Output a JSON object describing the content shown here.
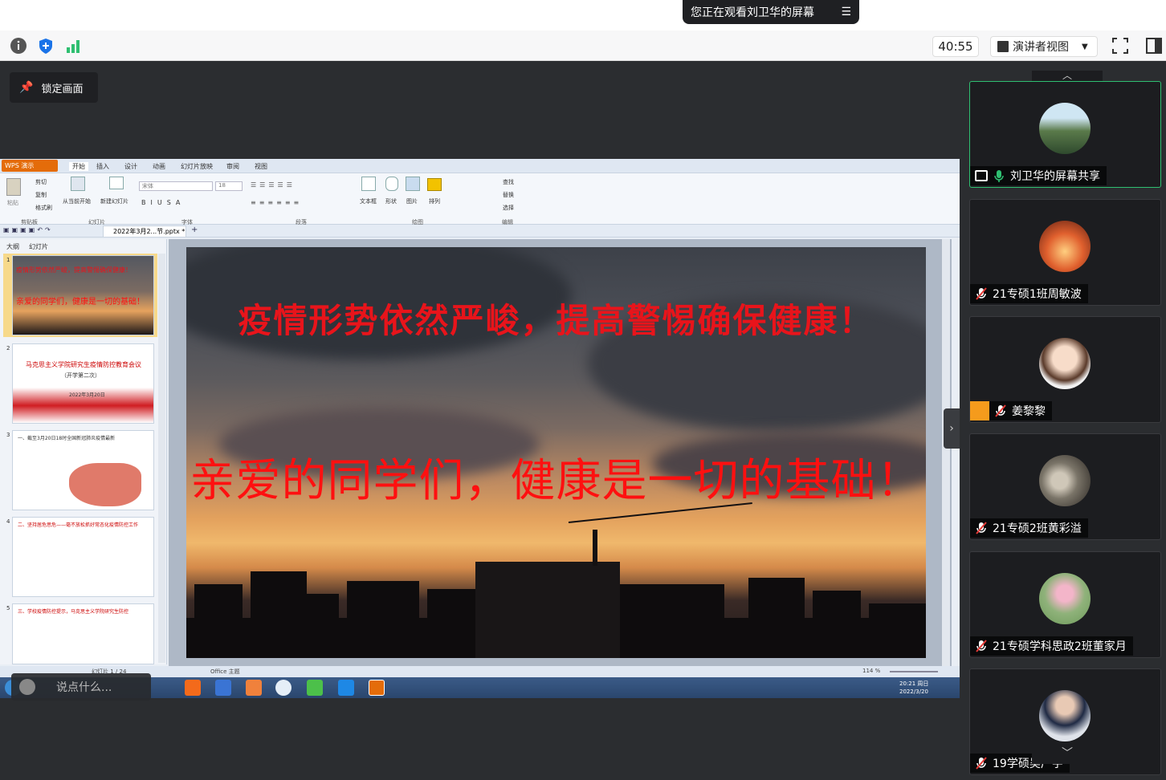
{
  "meeting": {
    "viewing_banner": "您正在观看刘卫华的屏幕",
    "timer": "40:55",
    "view_mode": "演讲者视图",
    "lock_screen": "锁定画面",
    "chat_placeholder": "说点什么..."
  },
  "wps": {
    "app_name": "WPS 演示",
    "ribbon_tabs": [
      "开始",
      "插入",
      "设计",
      "动画",
      "幻灯片放映",
      "审阅",
      "视图"
    ],
    "ribbon_groups": [
      "剪贴板",
      "幻灯片",
      "字体",
      "段落",
      "绘图",
      "编辑"
    ],
    "clipboard": [
      "剪切",
      "复制",
      "格式刷",
      "粘贴"
    ],
    "slides_buttons": [
      "从当前开始",
      "新建幻灯片"
    ],
    "draw_buttons": [
      "文本框",
      "形状",
      "图片",
      "排列"
    ],
    "edit_buttons": [
      "查找",
      "替换",
      "选择"
    ],
    "font_name": "宋体",
    "font_size": "18",
    "doc_tab": "2022年3月2...节.pptx *",
    "panel_tabs": [
      "大纲",
      "幻灯片"
    ],
    "status_theme": "Office 主题",
    "status_slide": "幻灯片 1 / 24",
    "zoom": "114 %",
    "clock_time": "20:21 周日",
    "clock_date": "2022/3/20"
  },
  "slide": {
    "title": "疫情形势依然严峻，提高警惕确保健康！",
    "subtitle": "亲爱的同学们，健康是一切的基础！"
  },
  "thumbnails": [
    {
      "num": "1",
      "line1": "疫情形势依然严峻，提高警惕确保健康！",
      "line2": "亲爱的同学们，健康是一切的基础！"
    },
    {
      "num": "2",
      "line1": "马克思主义学院研究生疫情防控教育会议",
      "line2": "（开学第二次）",
      "line3": "2022年3月20日"
    },
    {
      "num": "3",
      "line1": "一、截至3月20日18时全国新冠肺炎疫情最新"
    },
    {
      "num": "4",
      "line1": "二、坚持居危思危——毫不放松抓好常态化疫情防控工作"
    },
    {
      "num": "5",
      "line1": "三、学校疫情防控提示，马克思主义学院研究生防控"
    }
  ],
  "participants": [
    {
      "name": "刘卫华的屏幕共享",
      "active": true
    },
    {
      "name": "21专硕1班周敏波"
    },
    {
      "name": "姜黎黎"
    },
    {
      "name": "21专硕2班黄彩溢"
    },
    {
      "name": "21专硕学科思政2班董家月"
    },
    {
      "name": "19学硕吴广宇"
    }
  ],
  "colors": {
    "accent_green": "#2fbf71",
    "slide_red": "#e8141b",
    "wps_orange": "#e46c0a"
  }
}
